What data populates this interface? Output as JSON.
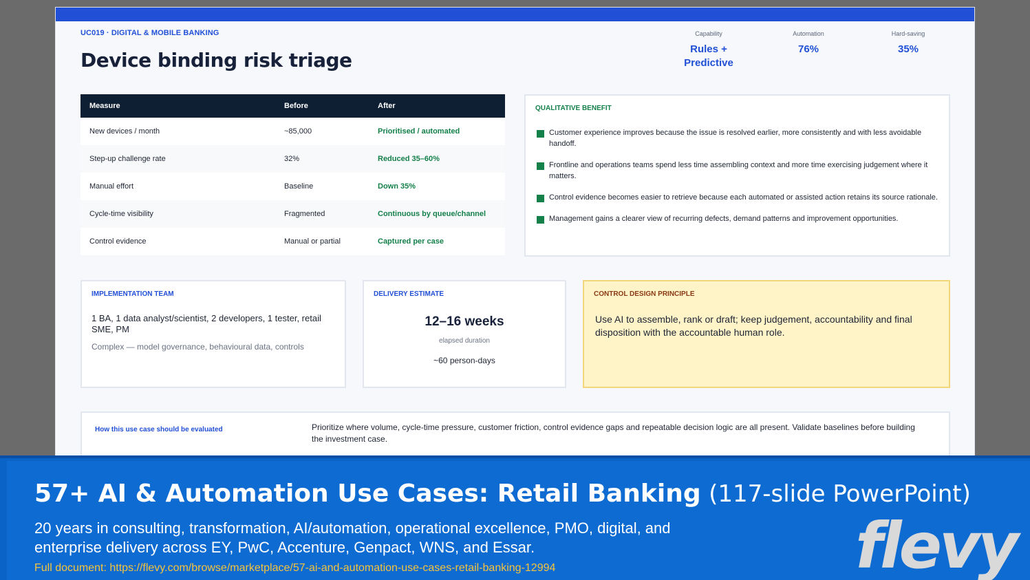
{
  "slide": {
    "eyebrow": "UC019 · DIGITAL & MOBILE BANKING",
    "title": "Device binding risk triage",
    "metrics": [
      {
        "label": "Capability",
        "value": "Rules + Predictive"
      },
      {
        "label": "Automation",
        "value": "76%"
      },
      {
        "label": "Hard-saving",
        "value": "35%"
      }
    ],
    "table": {
      "headers": [
        "Measure",
        "Before",
        "After"
      ],
      "rows": [
        [
          "New devices / month",
          "~85,000",
          "Prioritised / automated"
        ],
        [
          "Step-up challenge rate",
          "32%",
          "Reduced 35–60%"
        ],
        [
          "Manual effort",
          "Baseline",
          "Down 35%"
        ],
        [
          "Cycle-time visibility",
          "Fragmented",
          "Continuous by queue/channel"
        ],
        [
          "Control evidence",
          "Manual or partial",
          "Captured per case"
        ]
      ]
    },
    "qualitative": {
      "heading": "QUALITATIVE BENEFIT",
      "items": [
        "Customer experience improves because the issue is resolved earlier, more consistently and with less avoidable handoff.",
        "Frontline and operations teams spend less time assembling context and more time exercising judgement where it matters.",
        "Control evidence becomes easier to retrieve because each automated or assisted action retains its source rationale.",
        "Management gains a clearer view of recurring defects, demand patterns and improvement opportunities."
      ]
    },
    "team": {
      "heading": "IMPLEMENTATION TEAM",
      "members": "1 BA, 1 data analyst/scientist, 2 developers, 1 tester, retail SME, PM",
      "complexity": "Complex — model governance, behavioural data, controls"
    },
    "delivery": {
      "heading": "DELIVERY ESTIMATE",
      "duration": "12–16 weeks",
      "duration_label": "elapsed duration",
      "effort": "~60 person-days"
    },
    "principle": {
      "heading": "CONTROL DESIGN PRINCIPLE",
      "text": "Use AI to assemble, rank or draft; keep judgement, accountability and final disposition with the accountable human role."
    },
    "evaluation": {
      "label": "How this use case should be evaluated",
      "text": "Prioritize where volume, cycle-time pressure, customer friction, control evidence gaps and repeatable decision logic are all present. Validate baselines before building the investment case."
    }
  },
  "footer": {
    "title_bold": "57+ AI & Automation Use Cases: Retail Banking",
    "title_light": "(117-slide PowerPoint)",
    "description": "20 years in consulting, transformation, AI/automation, operational excellence, PMO, digital, and enterprise delivery across EY, PwC, Accenture, Genpact, WNS, and Essar.",
    "link": "Full document: https://flevy.com/browse/marketplace/57-ai-and-automation-use-cases-retail-banking-12994",
    "logo": "flevy"
  }
}
